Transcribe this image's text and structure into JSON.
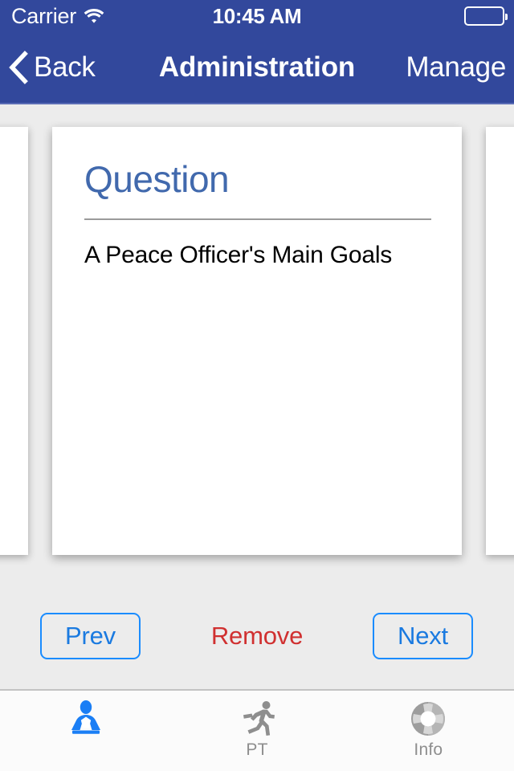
{
  "status_bar": {
    "carrier": "Carrier",
    "wifi_icon": "wifi-icon",
    "time": "10:45 AM",
    "battery_icon": "battery-icon",
    "battery_level_percent": 100
  },
  "nav_bar": {
    "back_icon": "chevron-left-icon",
    "back_label": "Back",
    "title": "Administration",
    "right_action_label": "Manage",
    "background_color": "#32489c"
  },
  "card": {
    "heading": "Question",
    "heading_color": "#4169ad",
    "body_text": "A Peace Officer's Main Goals",
    "has_previous_card": true,
    "has_next_card": true
  },
  "actions": {
    "prev_label": "Prev",
    "remove_label": "Remove",
    "next_label": "Next",
    "outline_color": "#1a8cff",
    "destructive_color": "#d03030"
  },
  "tab_bar": {
    "active_index": 0,
    "active_color": "#1a7ef5",
    "inactive_color": "#8e8e8e",
    "items": [
      {
        "icon": "administration-person-icon",
        "label": ""
      },
      {
        "icon": "running-person-icon",
        "label": "PT"
      },
      {
        "icon": "lifebuoy-icon",
        "label": "Info"
      }
    ]
  }
}
